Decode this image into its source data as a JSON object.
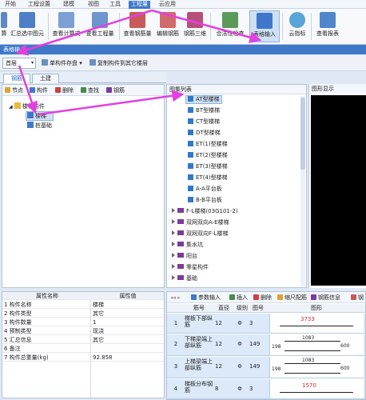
{
  "menubar": {
    "items": [
      "开始",
      "工程设置",
      "建模",
      "视图",
      "工具",
      "工程量",
      "云应用"
    ],
    "active_index": 5
  },
  "ribbon": {
    "buttons": [
      {
        "label": "算",
        "icon": "calc-icon"
      },
      {
        "label": "汇总选中图元",
        "icon": "sum-selected-icon"
      },
      {
        "label": "查看计算式",
        "icon": "view-formula-icon"
      },
      {
        "label": "查看工程量",
        "icon": "view-quantity-icon"
      },
      {
        "label": "查看钢筋量",
        "icon": "view-rebar-icon"
      },
      {
        "label": "编辑钢筋",
        "icon": "edit-rebar-icon"
      },
      {
        "label": "钢筋三维",
        "icon": "rebar-3d-icon"
      },
      {
        "label": "合法性检查",
        "icon": "validity-check-icon"
      },
      {
        "label": "表格输入",
        "icon": "table-input-icon"
      },
      {
        "label": "云指标",
        "icon": "cloud-index-icon"
      },
      {
        "label": "查看报表",
        "icon": "view-report-icon"
      }
    ],
    "selected_index": 8
  },
  "title_bar": {
    "text": "表格输入"
  },
  "toolbar": {
    "floor_value": "首层",
    "save_component_label": "单构件存盘",
    "copy_label": "复制构件到其它楼层"
  },
  "tabs": [
    {
      "label": "钢筋"
    },
    {
      "label": "土建"
    }
  ],
  "left_tools": [
    "节点",
    "构件",
    "删除",
    "查找",
    "钢筋"
  ],
  "tree": {
    "root": "楼梯构件",
    "children": [
      "楼梯",
      "桩基础"
    ],
    "selected_child": 0
  },
  "properties": {
    "header_name": "属性名称",
    "header_value": "属性值",
    "rows": [
      {
        "name": "1 构件名称",
        "value": "楼梯"
      },
      {
        "name": "2 构件类型",
        "value": "其它"
      },
      {
        "name": "3 构件数量",
        "value": "1"
      },
      {
        "name": "4 预制类型",
        "value": "现浇"
      },
      {
        "name": "5 汇总信息",
        "value": "其它"
      },
      {
        "name": "6 备注",
        "value": ""
      },
      {
        "name": "7 构件总重量(kg)",
        "value": "92.858"
      }
    ]
  },
  "pattern_list": {
    "header": "图集列表",
    "stair_types": [
      "AT型楼梯",
      "BT型楼梯",
      "CT型楼梯",
      "DT型楼梯",
      "ET(1)型楼梯",
      "ET(2)型楼梯",
      "ET(3)型楼梯",
      "ET(4)型楼梯",
      "A-A平台板",
      "B-B平台板"
    ],
    "selected_index": 0,
    "categories": [
      "F-L楼梯(03G101-2)",
      "双网双向A-E楼梯",
      "双网双向F-L楼梯",
      "集水坑",
      "阳台",
      "零星构件",
      "基础"
    ]
  },
  "graphic_panel": {
    "header": "图形显示"
  },
  "rebar_tools": [
    "参数输入",
    "插入",
    "删除",
    "缩尺配筋",
    "钢筋信息",
    "钢"
  ],
  "rebar_table": {
    "headers": [
      "筋号",
      "直径(mm)",
      "级别",
      "图号",
      "图形"
    ],
    "grade_symbol": "Φ",
    "rows": [
      {
        "num": "1",
        "name": "梯板下部纵筋",
        "diameter": "12",
        "count": "3",
        "fig": {
          "main": "3733"
        }
      },
      {
        "num": "2",
        "name": "下梯梁端上部纵筋",
        "diameter": "12",
        "count": "149",
        "fig": {
          "main": "1083",
          "left": "198",
          "right": "600"
        }
      },
      {
        "num": "3",
        "name": "上梯梁端上部纵筋",
        "diameter": "12",
        "count": "149",
        "fig": {
          "main": "1083",
          "left": "198",
          "right": "600"
        }
      },
      {
        "num": "4",
        "name": "梯板分布钢筋",
        "diameter": "8",
        "count": "3",
        "fig": {
          "main": "1570"
        }
      }
    ]
  },
  "colors": {
    "accent": "#3f78c9",
    "arrow": "#e23fe0",
    "category_icon": "#7b3a9e",
    "dimension_text": "#d42a2a"
  }
}
